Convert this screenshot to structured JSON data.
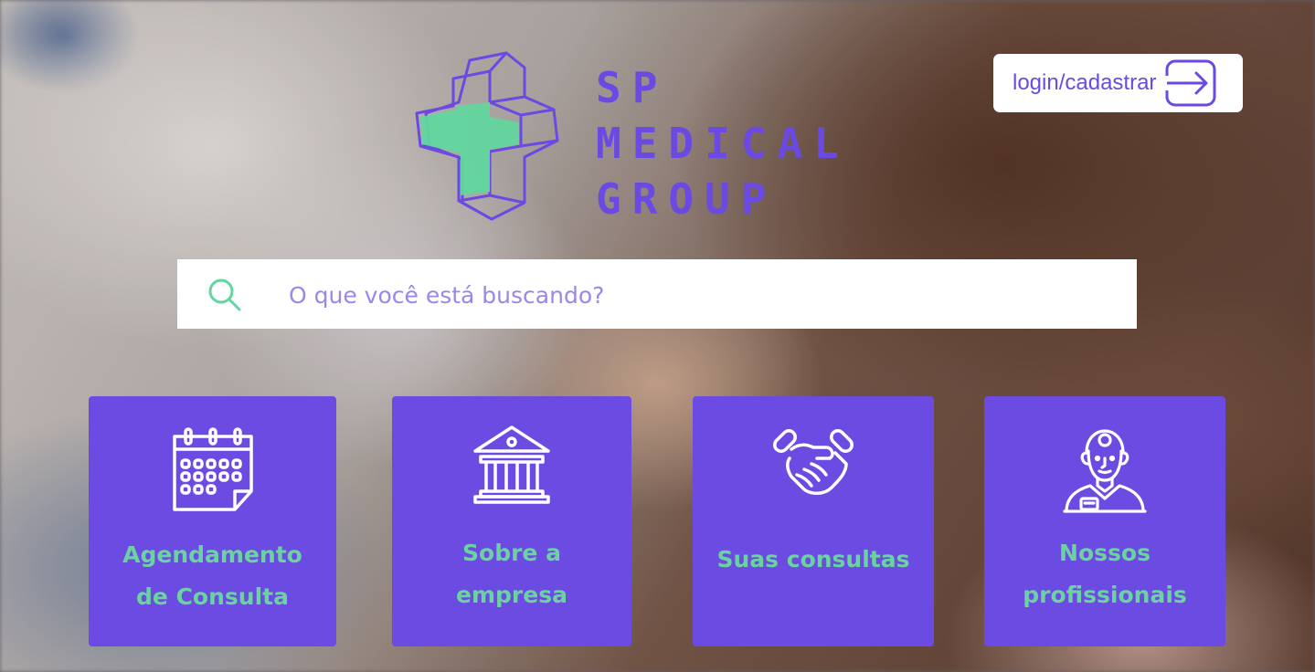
{
  "header": {
    "logo": {
      "line1": "SP",
      "line2": "MEDICAL",
      "line3": "GROUP"
    },
    "login_label": "login/cadastrar",
    "login_icon": "login-arrow-icon"
  },
  "search": {
    "placeholder": "O que você está buscando?",
    "icon": "search-icon"
  },
  "cards": [
    {
      "line1": "Agendamento",
      "line2": "de Consulta",
      "icon": "calendar-icon"
    },
    {
      "line1": "Sobre a",
      "line2": "empresa",
      "icon": "institution-building-icon"
    },
    {
      "line1": "Suas consultas",
      "line2": "",
      "icon": "handshake-icon"
    },
    {
      "line1": "Nossos",
      "line2": "profissionais",
      "icon": "doctor-icon"
    }
  ],
  "colors": {
    "accent_purple": "#6b4be2",
    "accent_green": "#6ad39f",
    "white": "#ffffff"
  }
}
